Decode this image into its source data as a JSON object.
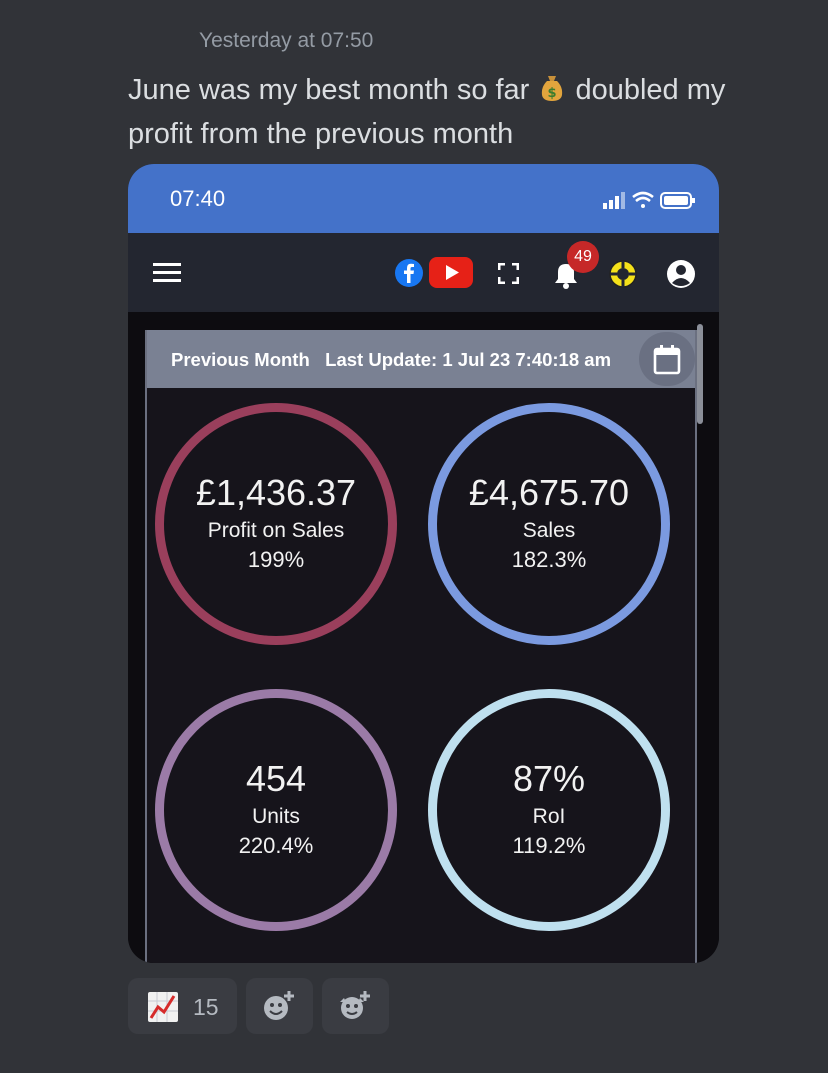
{
  "message": {
    "timestamp": "Yesterday at 07:50",
    "text_part1": "June was my best month so far",
    "text_part2": "doubled my profit from the previous month",
    "emoji": "money-bag-icon"
  },
  "phone": {
    "status_time": "07:40",
    "appbar": {
      "notification_badge": "49",
      "icons": [
        "menu-icon",
        "facebook-icon",
        "youtube-icon",
        "fullscreen-icon",
        "bell-icon",
        "support-icon",
        "account-icon"
      ]
    },
    "card": {
      "title": "Previous Month   Last Update: 1 Jul 23 7:40:18 am",
      "metrics": [
        {
          "value": "£1,436.37",
          "label": "Profit on Sales",
          "change": "199%",
          "color": "#9a3f5c"
        },
        {
          "value": "£4,675.70",
          "label": "Sales",
          "change": "182.3%",
          "color": "#7b9ae0"
        },
        {
          "value": "454",
          "label": "Units",
          "change": "220.4%",
          "color": "#9b7ba7"
        },
        {
          "value": "87%",
          "label": "RoI",
          "change": "119.2%",
          "color": "#bfe0ef"
        }
      ]
    }
  },
  "reactions": [
    {
      "emoji": "chart-increasing-icon",
      "count": "15"
    },
    {
      "emoji": "add-reaction-icon"
    },
    {
      "emoji": "add-super-reaction-icon"
    }
  ],
  "colors": {
    "background": "#313338",
    "statusbar": "#4472c9",
    "appbar": "#232630"
  }
}
